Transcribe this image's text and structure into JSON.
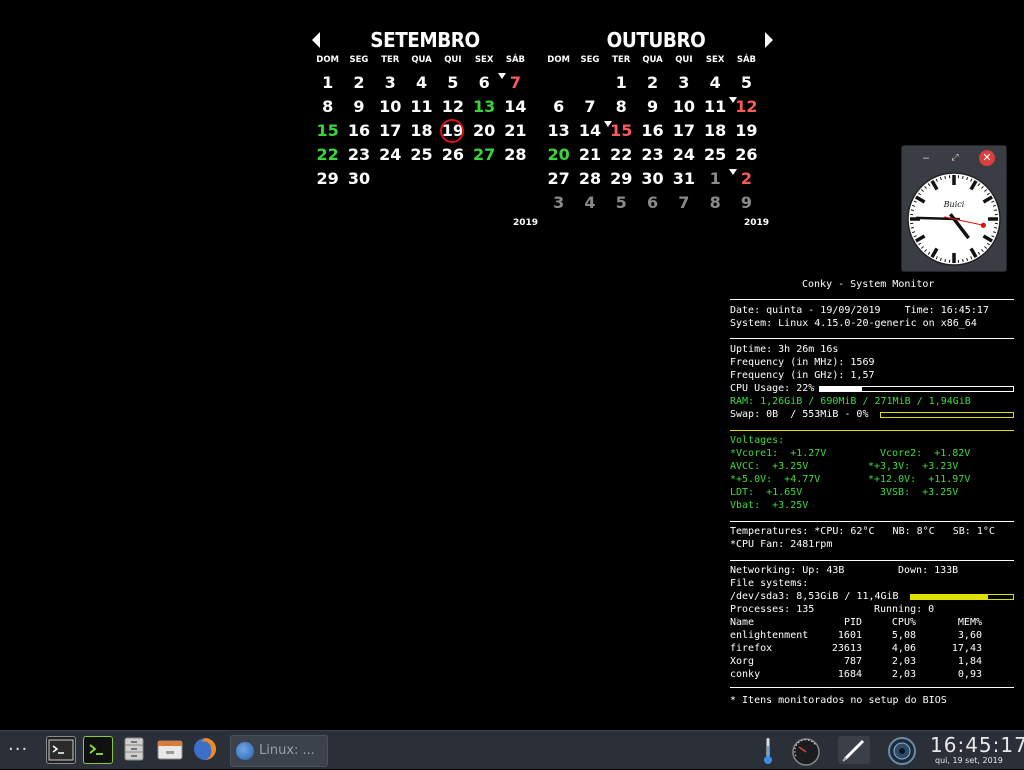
{
  "calendar": {
    "weekdays": [
      "DOM",
      "SEG",
      "TER",
      "QUA",
      "QUI",
      "SEX",
      "SÁB"
    ],
    "months": [
      {
        "name": "SETEMBRO",
        "year": "2019",
        "weeks": [
          [
            {
              "t": "1"
            },
            {
              "t": "2"
            },
            {
              "t": "3"
            },
            {
              "t": "4"
            },
            {
              "t": "5"
            },
            {
              "t": "6"
            },
            {
              "t": "7",
              "c": "red",
              "m": true
            }
          ],
          [
            {
              "t": "8"
            },
            {
              "t": "9"
            },
            {
              "t": "10"
            },
            {
              "t": "11"
            },
            {
              "t": "12"
            },
            {
              "t": "13",
              "c": "green"
            },
            {
              "t": "14"
            }
          ],
          [
            {
              "t": "15",
              "c": "green"
            },
            {
              "t": "16"
            },
            {
              "t": "17"
            },
            {
              "t": "18"
            },
            {
              "t": "19",
              "today": true
            },
            {
              "t": "20"
            },
            {
              "t": "21"
            }
          ],
          [
            {
              "t": "22",
              "c": "green"
            },
            {
              "t": "23"
            },
            {
              "t": "24"
            },
            {
              "t": "25"
            },
            {
              "t": "26"
            },
            {
              "t": "27",
              "c": "green"
            },
            {
              "t": "28"
            }
          ],
          [
            {
              "t": "29"
            },
            {
              "t": "30"
            },
            {
              "t": ""
            },
            {
              "t": ""
            },
            {
              "t": ""
            },
            {
              "t": ""
            },
            {
              "t": ""
            }
          ]
        ]
      },
      {
        "name": "OUTUBRO",
        "year": "2019",
        "weeks": [
          [
            {
              "t": ""
            },
            {
              "t": ""
            },
            {
              "t": "1"
            },
            {
              "t": "2"
            },
            {
              "t": "3"
            },
            {
              "t": "4"
            },
            {
              "t": "5"
            }
          ],
          [
            {
              "t": "6"
            },
            {
              "t": "7"
            },
            {
              "t": "8"
            },
            {
              "t": "9"
            },
            {
              "t": "10"
            },
            {
              "t": "11"
            },
            {
              "t": "12",
              "c": "red",
              "m": true
            }
          ],
          [
            {
              "t": "13"
            },
            {
              "t": "14"
            },
            {
              "t": "15",
              "c": "red",
              "m": true
            },
            {
              "t": "16"
            },
            {
              "t": "17"
            },
            {
              "t": "18"
            },
            {
              "t": "19"
            }
          ],
          [
            {
              "t": "20",
              "c": "green"
            },
            {
              "t": "21"
            },
            {
              "t": "22"
            },
            {
              "t": "23"
            },
            {
              "t": "24"
            },
            {
              "t": "25"
            },
            {
              "t": "26"
            }
          ],
          [
            {
              "t": "27"
            },
            {
              "t": "28"
            },
            {
              "t": "29"
            },
            {
              "t": "30"
            },
            {
              "t": "31"
            },
            {
              "t": "1",
              "c": "dim"
            },
            {
              "t": "2",
              "c": "red",
              "m": true
            }
          ],
          [
            {
              "t": "3",
              "c": "dim"
            },
            {
              "t": "4",
              "c": "dim"
            },
            {
              "t": "5",
              "c": "dim"
            },
            {
              "t": "6",
              "c": "dim"
            },
            {
              "t": "7",
              "c": "dim"
            },
            {
              "t": "8",
              "c": "dim"
            },
            {
              "t": "9",
              "c": "dim"
            }
          ]
        ]
      }
    ]
  },
  "clock_widget": {
    "brand": "Buici",
    "time": {
      "hours": 16,
      "minutes": 45,
      "seconds": 17
    },
    "buttons": {
      "minimize": "‒",
      "maximize": "⤢",
      "close": "✕"
    }
  },
  "conky": {
    "title": "Conky - System Monitor",
    "date_line": "Date: quinta - 19/09/2019    Time: 16:45:17",
    "system_line": "System: Linux 4.15.0-20-generic on x86_64",
    "uptime": "Uptime: 3h 26m 16s",
    "freq_mhz": "Frequency (in MHz): 1569",
    "freq_ghz": "Frequency (in GHz): 1,57",
    "cpu_usage": "CPU Usage: 22%",
    "cpu_usage_fraction": 0.22,
    "ram": "RAM: 1,26GiB / 690MiB / 271MiB / 1,94GiB",
    "swap": "Swap: 0B  / 553MiB - 0%",
    "swap_fraction": 0.0,
    "voltages_title": "Voltages:",
    "volt_rows": [
      [
        "*Vcore1:  +1.27V",
        "Vcore2:  +1.82V"
      ],
      [
        "AVCC:  +3.25V",
        "*+3,3V:  +3.23V"
      ],
      [
        "*+5.0V:  +4.77V",
        "*+12.0V:  +11.97V"
      ],
      [
        "LDT:  +1.65V",
        "3VSB:  +3.25V"
      ],
      [
        "Vbat:  +3.25V",
        ""
      ]
    ],
    "temps": "Temperatures: *CPU: 62°C   NB: 8°C   SB: 1°C",
    "fan": "*CPU Fan: 2481rpm",
    "net_up": "Networking: Up: 43B",
    "net_down": "Down: 133B",
    "fs_title": "File systems:",
    "fs_line": "/dev/sda3: 8,53GiB / 11,4GiB",
    "fs_fraction": 0.75,
    "processes": "Processes: 135",
    "running": "Running: 0",
    "proc_header": [
      "Name",
      "PID",
      "CPU%",
      "MEM%"
    ],
    "procs": [
      [
        "enlightenment",
        "1601",
        "5,08",
        "3,60"
      ],
      [
        "firefox",
        "23613",
        "4,06",
        "17,43"
      ],
      [
        "Xorg",
        "787",
        "2,03",
        "1,84"
      ],
      [
        "conky",
        "1684",
        "2,03",
        "0,93"
      ]
    ],
    "footnote": "* Itens monitorados no setup do BIOS"
  },
  "taskbar": {
    "menu_dots": "···",
    "task_label": "Linux: ...",
    "time": "16:45:17",
    "date": "qui, 19 set, 2019"
  }
}
